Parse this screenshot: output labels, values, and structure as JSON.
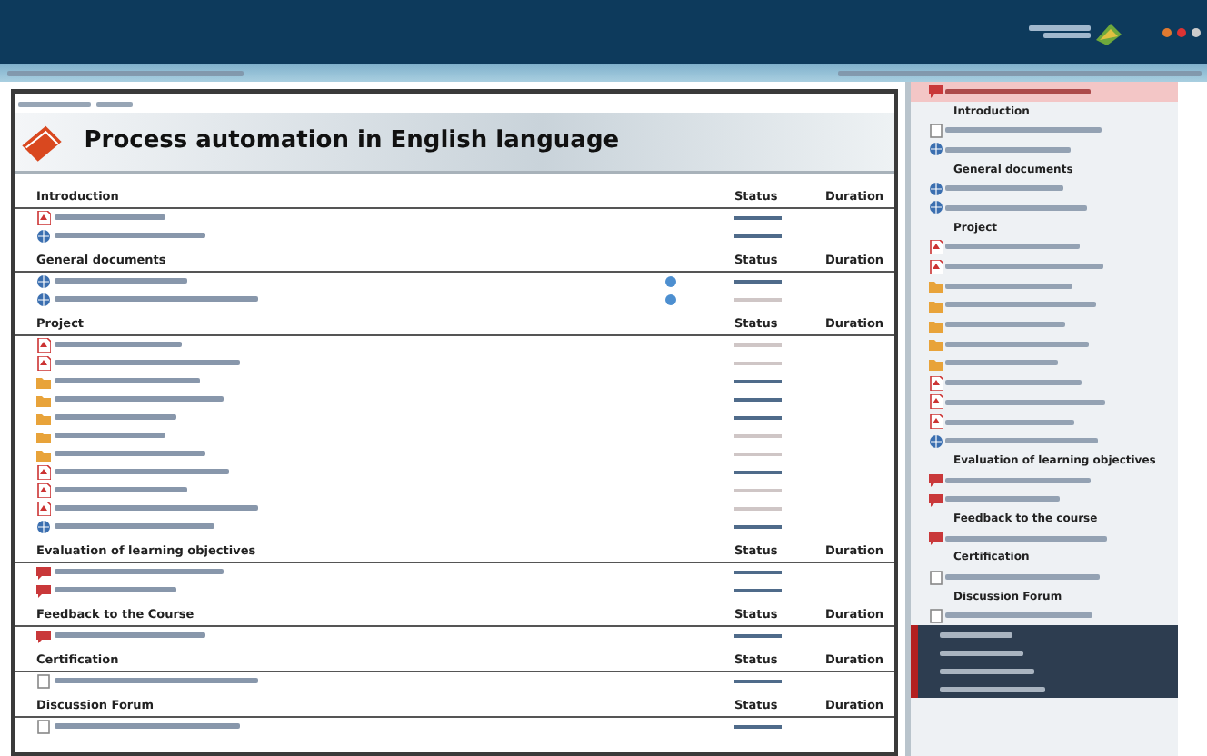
{
  "page": {
    "title": "Process automation in English language"
  },
  "sections": [
    {
      "title": "Introduction",
      "status_label": "Status",
      "duration_label": "Duration",
      "items": [
        {
          "kind": "pdf",
          "completed": true
        },
        {
          "kind": "web",
          "completed": true
        }
      ]
    },
    {
      "title": "General documents",
      "status_label": "Status",
      "duration_label": "Duration",
      "items": [
        {
          "kind": "web",
          "completed": true,
          "flag": true
        },
        {
          "kind": "web",
          "completed": false,
          "flag": true
        }
      ]
    },
    {
      "title": "Project",
      "status_label": "Status",
      "duration_label": "Duration",
      "items": [
        {
          "kind": "pdf",
          "completed": false
        },
        {
          "kind": "pdf",
          "completed": false
        },
        {
          "kind": "folder",
          "completed": true
        },
        {
          "kind": "folder",
          "completed": true
        },
        {
          "kind": "folder",
          "completed": true
        },
        {
          "kind": "folder",
          "completed": false
        },
        {
          "kind": "folder",
          "completed": false
        },
        {
          "kind": "pdf",
          "completed": true
        },
        {
          "kind": "pdf",
          "completed": false
        },
        {
          "kind": "pdf",
          "completed": false
        },
        {
          "kind": "web",
          "completed": true
        }
      ]
    },
    {
      "title": "Evaluation of learning objectives",
      "status_label": "Status",
      "duration_label": "Duration",
      "items": [
        {
          "kind": "forum",
          "completed": true
        },
        {
          "kind": "forum",
          "completed": true
        }
      ]
    },
    {
      "title": "Feedback to the Course",
      "status_label": "Status",
      "duration_label": "Duration",
      "items": [
        {
          "kind": "forum",
          "completed": true
        }
      ]
    },
    {
      "title": "Certification",
      "status_label": "Status",
      "duration_label": "Duration",
      "items": [
        {
          "kind": "doc",
          "completed": true
        }
      ]
    },
    {
      "title": "Discussion Forum",
      "status_label": "Status",
      "duration_label": "Duration",
      "items": [
        {
          "kind": "doc",
          "completed": true
        }
      ]
    }
  ],
  "sidebar": {
    "items": [
      {
        "kind": "current",
        "selected": true
      },
      {
        "kind": "section",
        "label": "Introduction"
      },
      {
        "kind": "doc"
      },
      {
        "kind": "web"
      },
      {
        "kind": "section",
        "label": "General documents"
      },
      {
        "kind": "web"
      },
      {
        "kind": "web"
      },
      {
        "kind": "section",
        "label": "Project"
      },
      {
        "kind": "pdf"
      },
      {
        "kind": "pdf"
      },
      {
        "kind": "folder"
      },
      {
        "kind": "folder"
      },
      {
        "kind": "folder"
      },
      {
        "kind": "folder"
      },
      {
        "kind": "folder"
      },
      {
        "kind": "pdf"
      },
      {
        "kind": "pdf"
      },
      {
        "kind": "pdf"
      },
      {
        "kind": "web"
      },
      {
        "kind": "section",
        "label": "Evaluation of learning objectives"
      },
      {
        "kind": "forum"
      },
      {
        "kind": "forum"
      },
      {
        "kind": "section",
        "label": "Feedback to the course"
      },
      {
        "kind": "forum"
      },
      {
        "kind": "section",
        "label": "Certification"
      },
      {
        "kind": "doc"
      },
      {
        "kind": "section",
        "label": "Discussion Forum"
      },
      {
        "kind": "doc"
      }
    ],
    "bottom_menu": [
      {
        "kind": "menu"
      },
      {
        "kind": "menu"
      },
      {
        "kind": "menu"
      },
      {
        "kind": "menu"
      }
    ]
  }
}
